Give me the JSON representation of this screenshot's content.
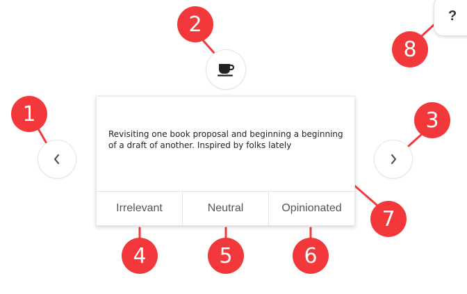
{
  "card": {
    "text": "Revisiting one book proposal and beginning a beginning of a draft of another. Inspired by folks lately",
    "actions": [
      {
        "label": "Irrelevant"
      },
      {
        "label": "Neutral"
      },
      {
        "label": "Opinionated"
      }
    ]
  },
  "buttons": {
    "help_label": "?",
    "prev_icon": "chevron-left-icon",
    "next_icon": "chevron-right-icon",
    "coffee_icon": "coffee-cup-icon"
  },
  "markers": [
    "1",
    "2",
    "3",
    "4",
    "5",
    "6",
    "7",
    "8"
  ],
  "colors": {
    "marker": "#f2383a",
    "text": "#222222",
    "action_text": "#555555",
    "border": "#e2e2e2"
  }
}
